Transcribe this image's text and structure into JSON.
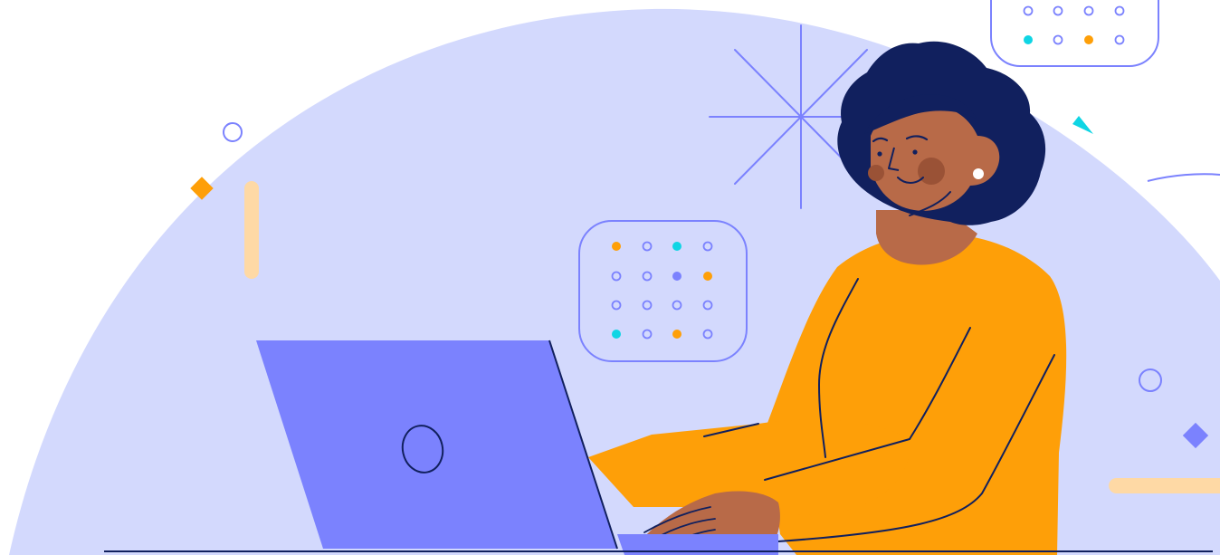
{
  "illustration": {
    "subject": "woman-typing-on-laptop",
    "palette": {
      "background": "#ffffff",
      "dome": "#d3d9fd",
      "accent_blue": "#7b82fe",
      "navy": "#11205e",
      "orange": "#fe9f08",
      "skin": "#b86a48",
      "cheek": "#9a5236",
      "cyan": "#0fd5e4",
      "peach": "#fed9a5"
    },
    "icons": [
      "dot-grid-icon",
      "sparkle-icon",
      "laptop-logo-icon",
      "diamond-icon",
      "ring-icon",
      "earring-icon"
    ]
  }
}
